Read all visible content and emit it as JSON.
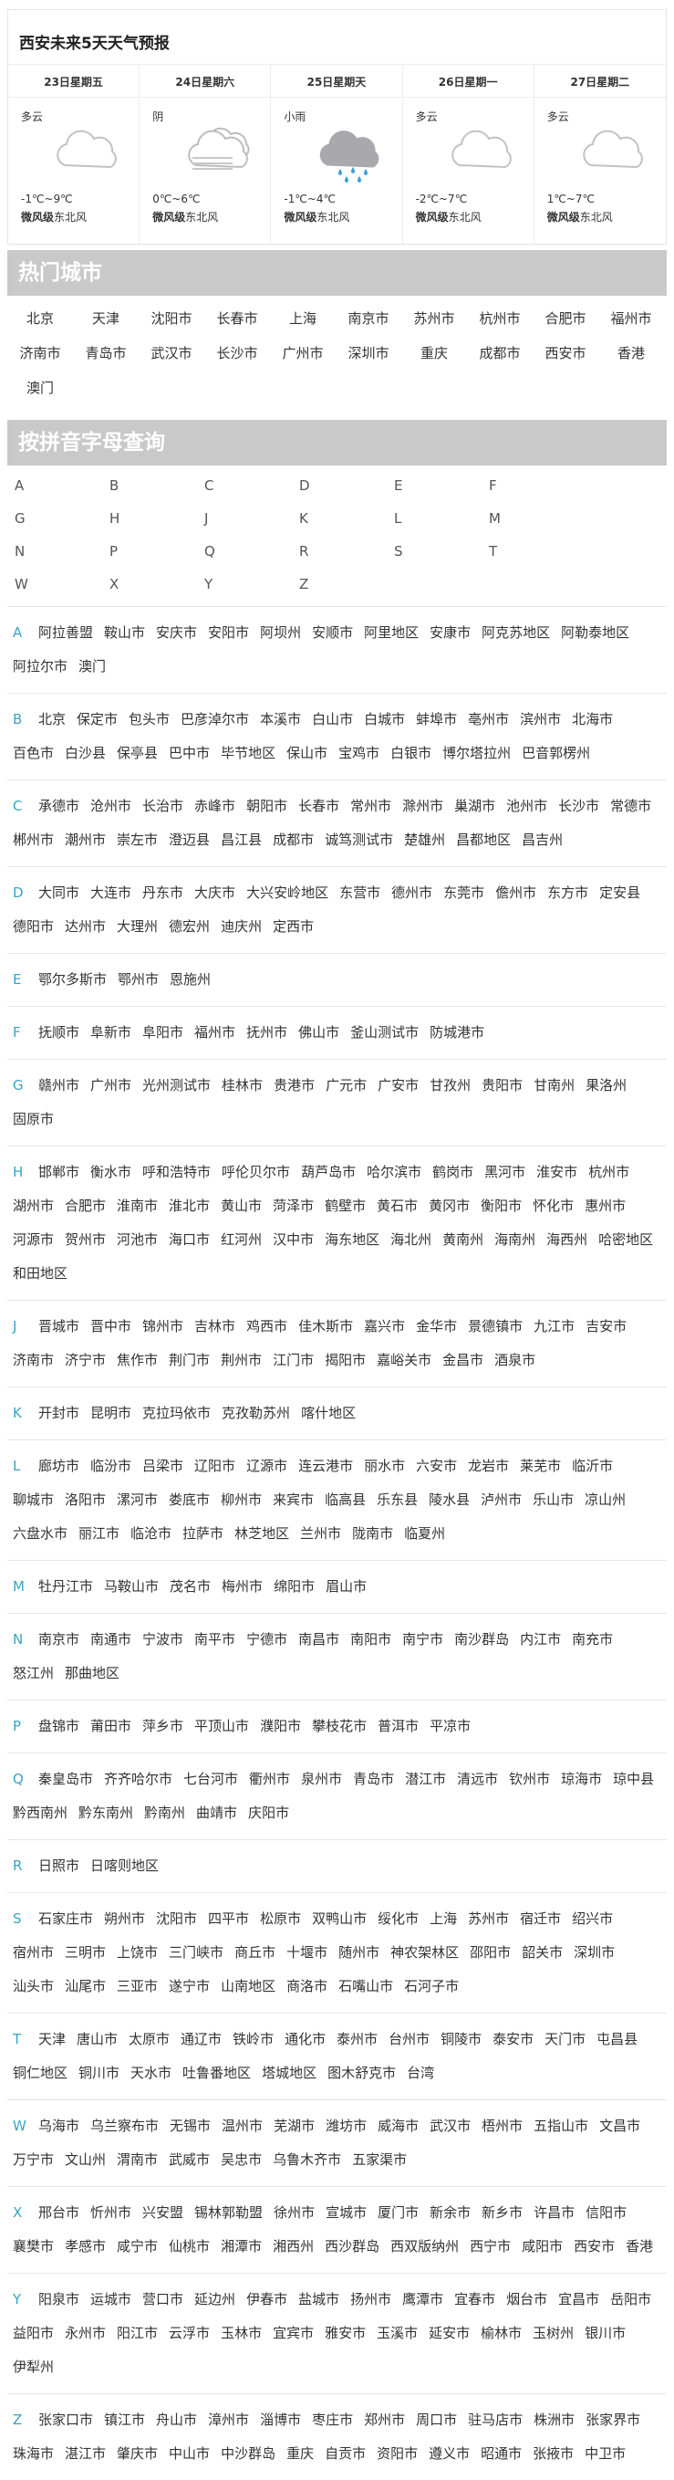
{
  "forecast": {
    "title": "西安未来5天天气预报",
    "days": [
      {
        "date": "23日星期五",
        "cond": "多云",
        "icon": "cloud-icon",
        "temp": "-1℃~9℃",
        "wind_level": "微风级",
        "wind_dir": "东北风"
      },
      {
        "date": "24日星期六",
        "cond": "阴",
        "icon": "overcast-icon",
        "temp": "0℃~6℃",
        "wind_level": "微风级",
        "wind_dir": "东北风"
      },
      {
        "date": "25日星期天",
        "cond": "小雨",
        "icon": "rain-icon",
        "temp": "-1℃~4℃",
        "wind_level": "微风级",
        "wind_dir": "东北风"
      },
      {
        "date": "26日星期一",
        "cond": "多云",
        "icon": "cloud-icon",
        "temp": "-2℃~7℃",
        "wind_level": "微风级",
        "wind_dir": "东北风"
      },
      {
        "date": "27日星期二",
        "cond": "多云",
        "icon": "cloud-icon",
        "temp": "1℃~7℃",
        "wind_level": "微风级",
        "wind_dir": "东北风"
      }
    ]
  },
  "hot_cities": {
    "title": "热门城市",
    "items": [
      "北京",
      "天津",
      "沈阳市",
      "长春市",
      "上海",
      "南京市",
      "苏州市",
      "杭州市",
      "合肥市",
      "福州市",
      "济南市",
      "青岛市",
      "武汉市",
      "长沙市",
      "广州市",
      "深圳市",
      "重庆",
      "成都市",
      "西安市",
      "香港",
      "澳门"
    ]
  },
  "pinyin": {
    "title": "按拼音字母查询",
    "letters": [
      "A",
      "B",
      "C",
      "D",
      "E",
      "F",
      "G",
      "H",
      "J",
      "K",
      "L",
      "M",
      "N",
      "P",
      "Q",
      "R",
      "S",
      "T",
      "W",
      "X",
      "Y",
      "Z"
    ]
  },
  "groups": [
    {
      "letter": "A",
      "cities": [
        "阿拉善盟",
        "鞍山市",
        "安庆市",
        "安阳市",
        "阿坝州",
        "安顺市",
        "阿里地区",
        "安康市",
        "阿克苏地区",
        "阿勒泰地区",
        "阿拉尔市",
        "澳门"
      ]
    },
    {
      "letter": "B",
      "cities": [
        "北京",
        "保定市",
        "包头市",
        "巴彦淖尔市",
        "本溪市",
        "白山市",
        "白城市",
        "蚌埠市",
        "亳州市",
        "滨州市",
        "北海市",
        "百色市",
        "白沙县",
        "保亭县",
        "巴中市",
        "毕节地区",
        "保山市",
        "宝鸡市",
        "白银市",
        "博尔塔拉州",
        "巴音郭楞州"
      ]
    },
    {
      "letter": "C",
      "cities": [
        "承德市",
        "沧州市",
        "长治市",
        "赤峰市",
        "朝阳市",
        "长春市",
        "常州市",
        "滁州市",
        "巢湖市",
        "池州市",
        "长沙市",
        "常德市",
        "郴州市",
        "潮州市",
        "崇左市",
        "澄迈县",
        "昌江县",
        "成都市",
        "诚笃测试市",
        "楚雄州",
        "昌都地区",
        "昌吉州"
      ]
    },
    {
      "letter": "D",
      "cities": [
        "大同市",
        "大连市",
        "丹东市",
        "大庆市",
        "大兴安岭地区",
        "东营市",
        "德州市",
        "东莞市",
        "儋州市",
        "东方市",
        "定安县",
        "德阳市",
        "达州市",
        "大理州",
        "德宏州",
        "迪庆州",
        "定西市"
      ]
    },
    {
      "letter": "E",
      "cities": [
        "鄂尔多斯市",
        "鄂州市",
        "恩施州"
      ]
    },
    {
      "letter": "F",
      "cities": [
        "抚顺市",
        "阜新市",
        "阜阳市",
        "福州市",
        "抚州市",
        "佛山市",
        "釜山测试市",
        "防城港市"
      ]
    },
    {
      "letter": "G",
      "cities": [
        "赣州市",
        "广州市",
        "光州测试市",
        "桂林市",
        "贵港市",
        "广元市",
        "广安市",
        "甘孜州",
        "贵阳市",
        "甘南州",
        "果洛州",
        "固原市"
      ]
    },
    {
      "letter": "H",
      "cities": [
        "邯郸市",
        "衡水市",
        "呼和浩特市",
        "呼伦贝尔市",
        "葫芦岛市",
        "哈尔滨市",
        "鹤岗市",
        "黑河市",
        "淮安市",
        "杭州市",
        "湖州市",
        "合肥市",
        "淮南市",
        "淮北市",
        "黄山市",
        "菏泽市",
        "鹤壁市",
        "黄石市",
        "黄冈市",
        "衡阳市",
        "怀化市",
        "惠州市",
        "河源市",
        "贺州市",
        "河池市",
        "海口市",
        "红河州",
        "汉中市",
        "海东地区",
        "海北州",
        "黄南州",
        "海南州",
        "海西州",
        "哈密地区",
        "和田地区"
      ]
    },
    {
      "letter": "J",
      "cities": [
        "晋城市",
        "晋中市",
        "锦州市",
        "吉林市",
        "鸡西市",
        "佳木斯市",
        "嘉兴市",
        "金华市",
        "景德镇市",
        "九江市",
        "吉安市",
        "济南市",
        "济宁市",
        "焦作市",
        "荆门市",
        "荆州市",
        "江门市",
        "揭阳市",
        "嘉峪关市",
        "金昌市",
        "酒泉市"
      ]
    },
    {
      "letter": "K",
      "cities": [
        "开封市",
        "昆明市",
        "克拉玛依市",
        "克孜勒苏州",
        "喀什地区"
      ]
    },
    {
      "letter": "L",
      "cities": [
        "廊坊市",
        "临汾市",
        "吕梁市",
        "辽阳市",
        "辽源市",
        "连云港市",
        "丽水市",
        "六安市",
        "龙岩市",
        "莱芜市",
        "临沂市",
        "聊城市",
        "洛阳市",
        "漯河市",
        "娄底市",
        "柳州市",
        "来宾市",
        "临高县",
        "乐东县",
        "陵水县",
        "泸州市",
        "乐山市",
        "凉山州",
        "六盘水市",
        "丽江市",
        "临沧市",
        "拉萨市",
        "林芝地区",
        "兰州市",
        "陇南市",
        "临夏州"
      ]
    },
    {
      "letter": "M",
      "cities": [
        "牡丹江市",
        "马鞍山市",
        "茂名市",
        "梅州市",
        "绵阳市",
        "眉山市"
      ]
    },
    {
      "letter": "N",
      "cities": [
        "南京市",
        "南通市",
        "宁波市",
        "南平市",
        "宁德市",
        "南昌市",
        "南阳市",
        "南宁市",
        "南沙群岛",
        "内江市",
        "南充市",
        "怒江州",
        "那曲地区"
      ]
    },
    {
      "letter": "P",
      "cities": [
        "盘锦市",
        "莆田市",
        "萍乡市",
        "平顶山市",
        "濮阳市",
        "攀枝花市",
        "普洱市",
        "平凉市"
      ]
    },
    {
      "letter": "Q",
      "cities": [
        "秦皇岛市",
        "齐齐哈尔市",
        "七台河市",
        "衢州市",
        "泉州市",
        "青岛市",
        "潜江市",
        "清远市",
        "钦州市",
        "琼海市",
        "琼中县",
        "黔西南州",
        "黔东南州",
        "黔南州",
        "曲靖市",
        "庆阳市"
      ]
    },
    {
      "letter": "R",
      "cities": [
        "日照市",
        "日喀则地区"
      ]
    },
    {
      "letter": "S",
      "cities": [
        "石家庄市",
        "朔州市",
        "沈阳市",
        "四平市",
        "松原市",
        "双鸭山市",
        "绥化市",
        "上海",
        "苏州市",
        "宿迁市",
        "绍兴市",
        "宿州市",
        "三明市",
        "上饶市",
        "三门峡市",
        "商丘市",
        "十堰市",
        "随州市",
        "神农架林区",
        "邵阳市",
        "韶关市",
        "深圳市",
        "汕头市",
        "汕尾市",
        "三亚市",
        "遂宁市",
        "山南地区",
        "商洛市",
        "石嘴山市",
        "石河子市"
      ]
    },
    {
      "letter": "T",
      "cities": [
        "天津",
        "唐山市",
        "太原市",
        "通辽市",
        "铁岭市",
        "通化市",
        "泰州市",
        "台州市",
        "铜陵市",
        "泰安市",
        "天门市",
        "屯昌县",
        "铜仁地区",
        "铜川市",
        "天水市",
        "吐鲁番地区",
        "塔城地区",
        "图木舒克市",
        "台湾"
      ]
    },
    {
      "letter": "W",
      "cities": [
        "乌海市",
        "乌兰察布市",
        "无锡市",
        "温州市",
        "芜湖市",
        "潍坊市",
        "威海市",
        "武汉市",
        "梧州市",
        "五指山市",
        "文昌市",
        "万宁市",
        "文山州",
        "渭南市",
        "武威市",
        "吴忠市",
        "乌鲁木齐市",
        "五家渠市"
      ]
    },
    {
      "letter": "X",
      "cities": [
        "邢台市",
        "忻州市",
        "兴安盟",
        "锡林郭勒盟",
        "徐州市",
        "宣城市",
        "厦门市",
        "新余市",
        "新乡市",
        "许昌市",
        "信阳市",
        "襄樊市",
        "孝感市",
        "咸宁市",
        "仙桃市",
        "湘潭市",
        "湘西州",
        "西沙群岛",
        "西双版纳州",
        "西宁市",
        "咸阳市",
        "西安市",
        "香港"
      ]
    },
    {
      "letter": "Y",
      "cities": [
        "阳泉市",
        "运城市",
        "营口市",
        "延边州",
        "伊春市",
        "盐城市",
        "扬州市",
        "鹰潭市",
        "宜春市",
        "烟台市",
        "宜昌市",
        "岳阳市",
        "益阳市",
        "永州市",
        "阳江市",
        "云浮市",
        "玉林市",
        "宜宾市",
        "雅安市",
        "玉溪市",
        "延安市",
        "榆林市",
        "玉树州",
        "银川市",
        "伊犁州"
      ]
    },
    {
      "letter": "Z",
      "cities": [
        "张家口市",
        "镇江市",
        "舟山市",
        "漳州市",
        "淄博市",
        "枣庄市",
        "郑州市",
        "周口市",
        "驻马店市",
        "株洲市",
        "张家界市",
        "珠海市",
        "湛江市",
        "肇庆市",
        "中山市",
        "中沙群岛",
        "重庆",
        "自贡市",
        "资阳市",
        "遵义市",
        "昭通市",
        "张掖市",
        "中卫市"
      ]
    }
  ]
}
